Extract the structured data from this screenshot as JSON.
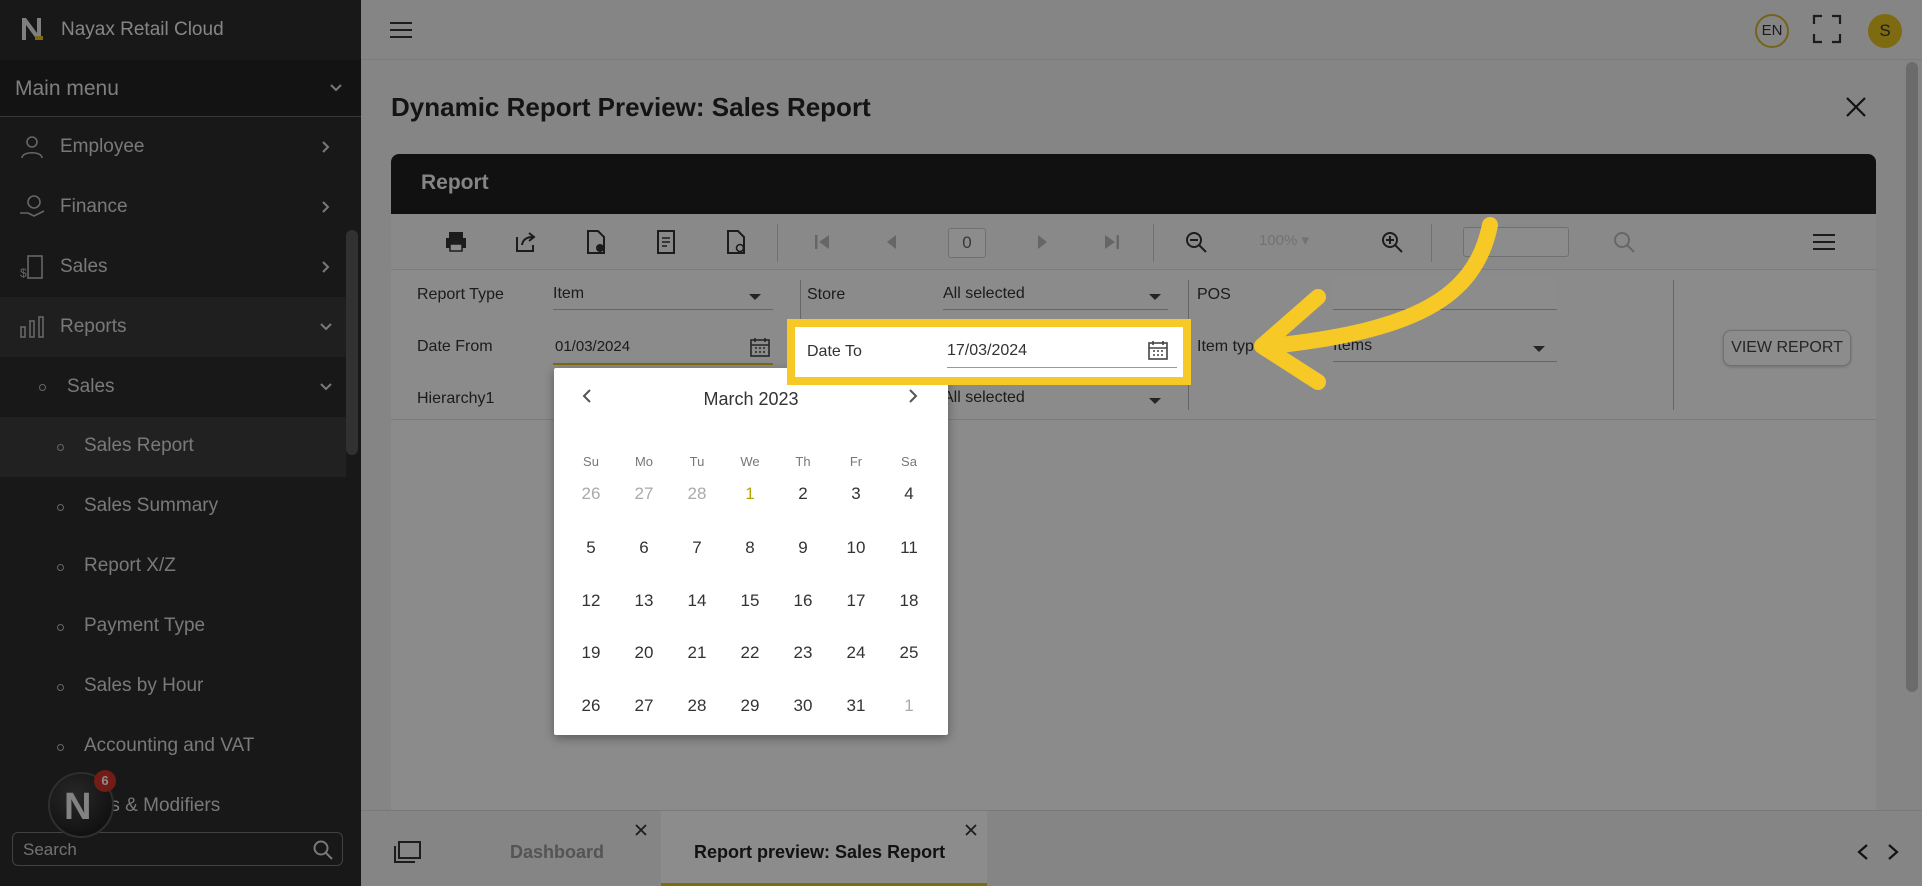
{
  "app": {
    "name": "Nayax Retail Cloud"
  },
  "sidebar": {
    "main_menu_label": "Main menu",
    "items": [
      {
        "label": "Employee",
        "icon": "employee-icon"
      },
      {
        "label": "Finance",
        "icon": "finance-icon"
      },
      {
        "label": "Sales",
        "icon": "sales-icon"
      },
      {
        "label": "Reports",
        "icon": "reports-icon"
      }
    ],
    "sub_group": {
      "label": "Sales"
    },
    "sub_items": [
      {
        "label": "Sales Report"
      },
      {
        "label": "Sales Summary"
      },
      {
        "label": "Report X/Z"
      },
      {
        "label": "Payment Type"
      },
      {
        "label": "Sales by Hour"
      },
      {
        "label": "Accounting and VAT"
      },
      {
        "label": "...es & Modifiers"
      }
    ],
    "search_placeholder": "Search",
    "fab_badge": "6"
  },
  "header": {
    "language": "EN",
    "avatar_initial": "S"
  },
  "page": {
    "title": "Dynamic Report Preview: Sales Report",
    "panel_title": "Report"
  },
  "toolbar": {
    "page_number": "0",
    "zoom": "100%"
  },
  "filters": {
    "report_type_label": "Report Type",
    "report_type_value": "Item",
    "store_label": "Store",
    "store_value": "All selected",
    "pos_label": "POS",
    "date_from_label": "Date From",
    "date_from_value": "01/03/2024",
    "date_to_label": "Date To",
    "date_to_value": "17/03/2024",
    "item_type_label": "Item type",
    "item_type_value": "Items",
    "hierarchy_label": "Hierarchy1",
    "hierarchy_value": "All selected",
    "view_report_label": "VIEW REPORT"
  },
  "calendar": {
    "title": "March 2023",
    "weekdays": [
      "Su",
      "Mo",
      "Tu",
      "We",
      "Th",
      "Fr",
      "Sa"
    ],
    "weeks": [
      [
        "26",
        "27",
        "28",
        "1",
        "2",
        "3",
        "4"
      ],
      [
        "5",
        "6",
        "7",
        "8",
        "9",
        "10",
        "11"
      ],
      [
        "12",
        "13",
        "14",
        "15",
        "16",
        "17",
        "18"
      ],
      [
        "19",
        "20",
        "21",
        "22",
        "23",
        "24",
        "25"
      ],
      [
        "26",
        "27",
        "28",
        "29",
        "30",
        "31",
        "1"
      ]
    ],
    "accent_color": "#b6a600"
  },
  "bottom_tabs": [
    {
      "label": "Dashboard",
      "active": false
    },
    {
      "label": "Report preview: Sales Report",
      "active": true
    }
  ],
  "colors": {
    "brand_yellow": "#e6c21e",
    "highlight_yellow": "#f6c927",
    "sidebar_bg": "#2d2d2d"
  }
}
